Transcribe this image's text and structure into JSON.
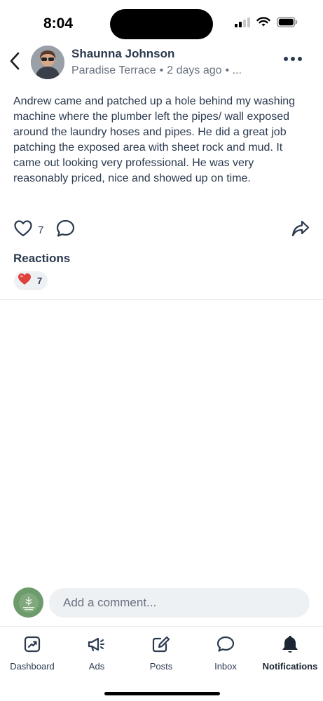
{
  "status_bar": {
    "time": "8:04"
  },
  "post": {
    "author": "Shaunna Johnson",
    "neighborhood": "Paradise Terrace",
    "separator": "•",
    "time_ago": "2 days ago",
    "meta_tail": "• ...",
    "body": "Andrew came and patched up a hole behind my washing machine where the plumber left the pipes/ wall exposed around the laundry hoses and pipes. He did a great job patching the exposed area with sheet rock and mud.  It came out looking very professional.  He was very reasonably priced,  nice and showed up on time.",
    "like_count": "7"
  },
  "reactions": {
    "title": "Reactions",
    "items": [
      {
        "emoji": "heart-icon",
        "count": "7"
      }
    ]
  },
  "comment": {
    "placeholder": "Add a comment..."
  },
  "tabs": [
    {
      "label": "Dashboard",
      "icon": "chart-icon"
    },
    {
      "label": "Ads",
      "icon": "megaphone-icon"
    },
    {
      "label": "Posts",
      "icon": "pencil-square-icon"
    },
    {
      "label": "Inbox",
      "icon": "chat-bubble-icon"
    },
    {
      "label": "Notifications",
      "icon": "bell-icon",
      "active": true
    }
  ],
  "colors": {
    "text_primary": "#2b3a4f",
    "text_secondary": "#697180",
    "heart": "#e0403b",
    "group_avatar": "#6e9b6c"
  }
}
